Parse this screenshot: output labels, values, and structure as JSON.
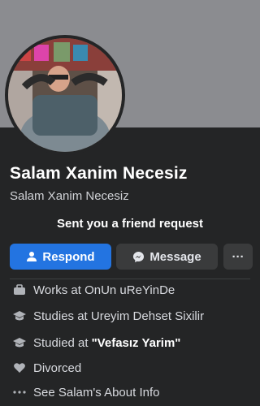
{
  "profile": {
    "name": "Salam Xanim Necesiz",
    "subname": "Salam Xanim Necesiz",
    "request_text": "Sent you a friend request"
  },
  "actions": {
    "respond_label": "Respond",
    "message_label": "Message",
    "more_label": "···"
  },
  "info": {
    "work_prefix": "Works at",
    "work_place": "OnUn uReYinDe",
    "study1_prefix": "Studies at",
    "study1_place": "Ureyim Dehset Sixilir",
    "study2_prefix": "Studied at",
    "study2_place": "\"Vefasız Yarim\"",
    "relationship": "Divorced",
    "about_link": "See Salam's About Info"
  },
  "icons": [
    "person-icon",
    "messenger-icon",
    "more-icon",
    "briefcase-icon",
    "graduation-cap-icon",
    "heart-icon",
    "ellipsis-icon"
  ],
  "colors": {
    "accent": "#2374e1",
    "background": "#242526",
    "cover": "#8b8c90",
    "button": "#3a3b3c"
  }
}
